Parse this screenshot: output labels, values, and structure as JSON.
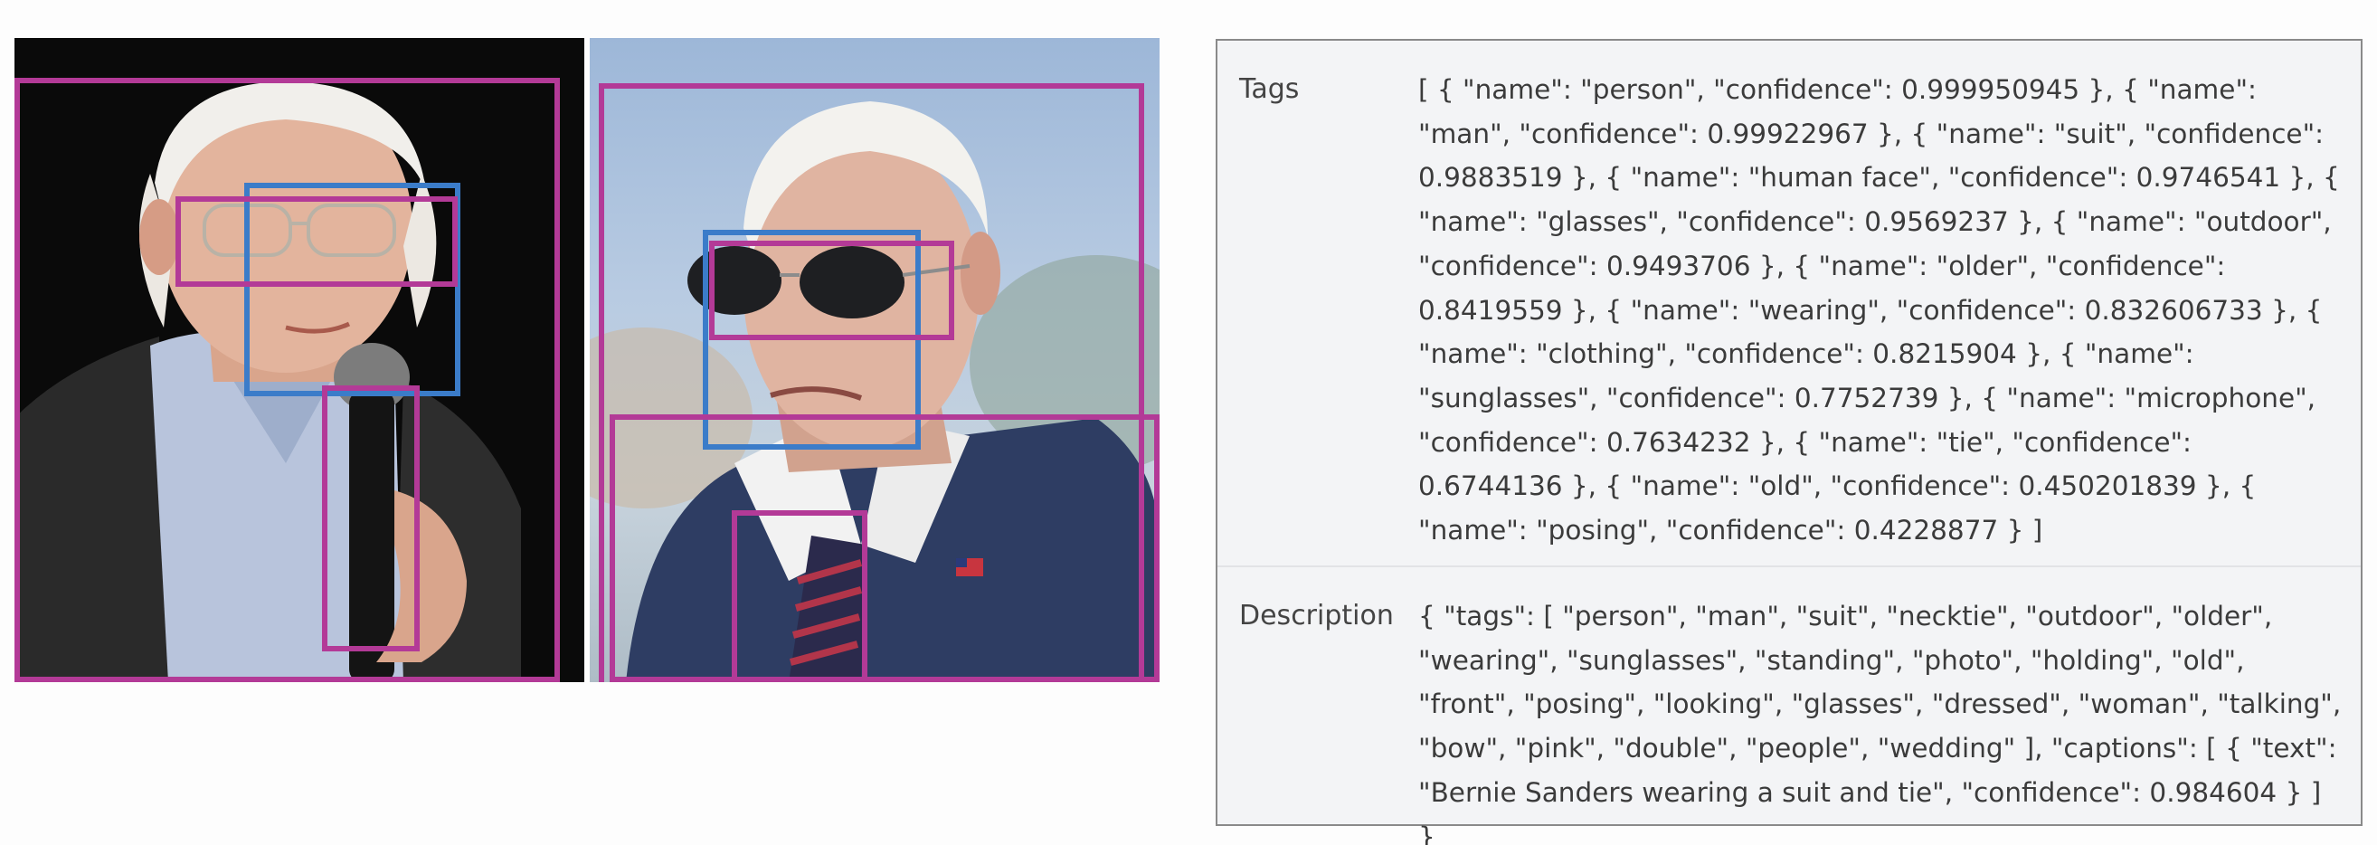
{
  "analysis": {
    "tags_label": "Tags",
    "tags_value": "[ { \"name\": \"person\", \"confidence\": 0.999950945 }, { \"name\": \"man\", \"confidence\": 0.99922967 }, { \"name\": \"suit\", \"confidence\": 0.9883519 }, { \"name\": \"human face\", \"confidence\": 0.9746541 }, { \"name\": \"glasses\", \"confidence\": 0.9569237 }, { \"name\": \"outdoor\", \"confidence\": 0.9493706 }, { \"name\": \"older\", \"confidence\": 0.8419559 }, { \"name\": \"wearing\", \"confidence\": 0.832606733 }, { \"name\": \"clothing\", \"confidence\": 0.8215904 }, { \"name\": \"sunglasses\", \"confidence\": 0.7752739 }, { \"name\": \"microphone\", \"confidence\": 0.7634232 }, { \"name\": \"tie\", \"confidence\": 0.6744136 }, { \"name\": \"old\", \"confidence\": 0.450201839 }, { \"name\": \"posing\", \"confidence\": 0.4228877 } ]",
    "description_label": "Description",
    "description_value": "{ \"tags\": [ \"person\", \"man\", \"suit\", \"necktie\", \"outdoor\", \"older\", \"wearing\", \"sunglasses\", \"standing\", \"photo\", \"holding\", \"old\", \"front\", \"posing\", \"looking\", \"glasses\", \"dressed\", \"woman\", \"talking\", \"bow\", \"pink\", \"double\", \"people\", \"wedding\" ], \"captions\": [ { \"text\": \"Bernie Sanders wearing a suit and tie\", \"confidence\": 0.984604 } ] }"
  },
  "colors": {
    "object_box": "#b33a97",
    "face_box": "#3b7cc9",
    "table_background": "#f3f4f6",
    "table_border": "#8a8a8a"
  }
}
